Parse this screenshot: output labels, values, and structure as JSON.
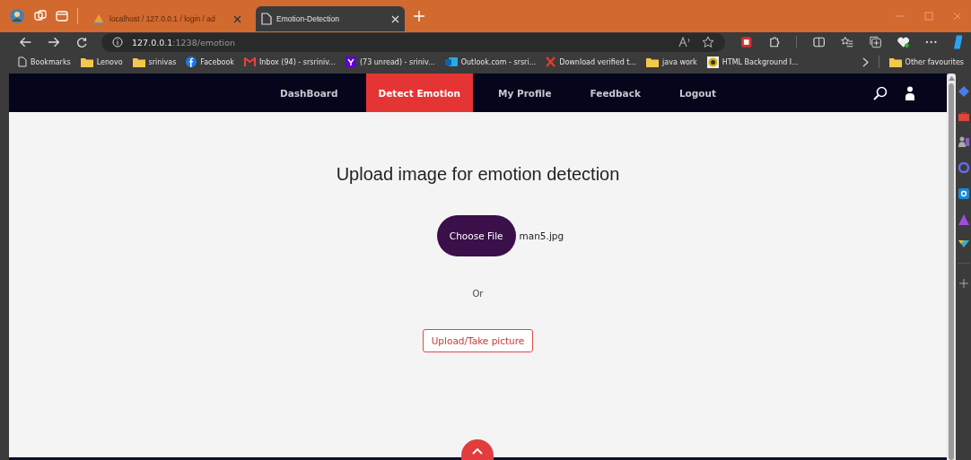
{
  "browser": {
    "tabs": [
      {
        "title": "localhost / 127.0.0.1 / login / ad",
        "kind": "db",
        "selected": false
      },
      {
        "title": "Emotion-Detection",
        "kind": "page",
        "selected": true
      }
    ],
    "address": {
      "host": "127.0.0.1",
      "path": ":1238/emotion"
    },
    "bookmarks": [
      {
        "label": "Bookmarks",
        "kind": "page"
      },
      {
        "label": "Lenovo",
        "kind": "folder"
      },
      {
        "label": "srinivas",
        "kind": "folder"
      },
      {
        "label": "Facebook",
        "kind": "facebook"
      },
      {
        "label": "Inbox (94) - srsriniv...",
        "kind": "mail"
      },
      {
        "label": "(73 unread) - sriniv...",
        "kind": "yahoo"
      },
      {
        "label": "Outlook.com - srsri...",
        "kind": "outlook"
      },
      {
        "label": "Download verified t...",
        "kind": "cross"
      },
      {
        "label": "java work",
        "kind": "folder"
      },
      {
        "label": "HTML Background I...",
        "kind": "target"
      }
    ],
    "other_favourites": "Other favourites"
  },
  "nav": [
    {
      "label": "DashBoard",
      "selected": false
    },
    {
      "label": "Detect Emotion",
      "selected": true
    },
    {
      "label": "My Profile",
      "selected": false
    },
    {
      "label": "Feedback",
      "selected": false
    },
    {
      "label": "Logout",
      "selected": false
    }
  ],
  "heading": "Upload image for emotion detection",
  "file_button": "Choose File",
  "file_name": "man5.jpg",
  "or_text": "Or",
  "upload_button": "Upload/Take picture"
}
